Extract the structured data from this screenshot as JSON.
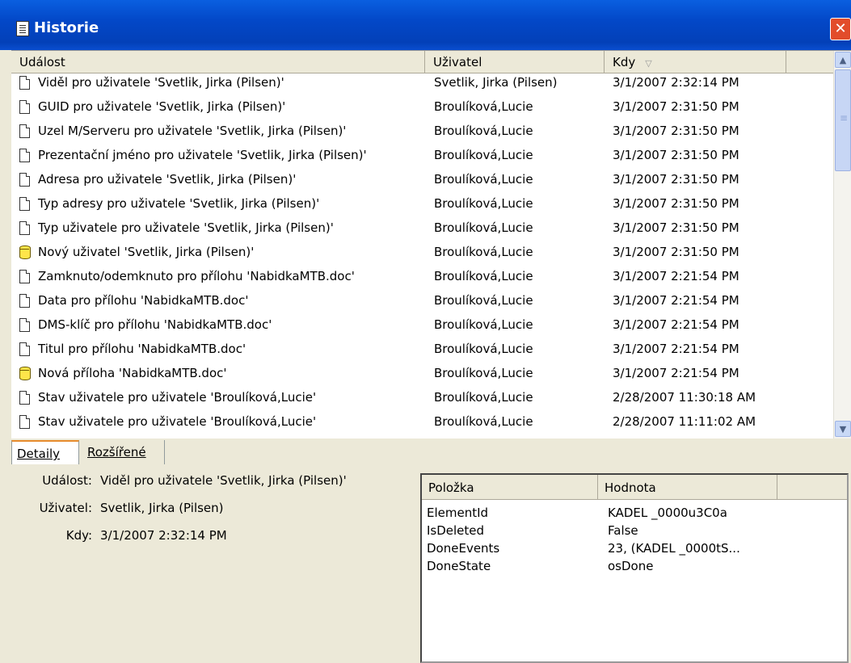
{
  "window": {
    "title": "Historie",
    "icon": "document-list-icon",
    "close_label": "✕"
  },
  "columns": {
    "event": "Událost",
    "user": "Uživatel",
    "when": "Kdy"
  },
  "rows": [
    {
      "icon": "doc",
      "event": "Viděl pro uživatele 'Svetlik, Jirka (Pilsen)'",
      "user": "Svetlik, Jirka (Pilsen)",
      "when": "3/1/2007 2:32:14 PM"
    },
    {
      "icon": "doc",
      "event": "GUID pro uživatele 'Svetlik, Jirka (Pilsen)'",
      "user": "Broulíková,Lucie",
      "when": "3/1/2007 2:31:50 PM"
    },
    {
      "icon": "doc",
      "event": "Uzel M/Serveru pro uživatele 'Svetlik, Jirka (Pilsen)'",
      "user": "Broulíková,Lucie",
      "when": "3/1/2007 2:31:50 PM"
    },
    {
      "icon": "doc",
      "event": "Prezentační jméno pro uživatele 'Svetlik, Jirka (Pilsen)'",
      "user": "Broulíková,Lucie",
      "when": "3/1/2007 2:31:50 PM"
    },
    {
      "icon": "doc",
      "event": "Adresa pro uživatele 'Svetlik, Jirka (Pilsen)'",
      "user": "Broulíková,Lucie",
      "when": "3/1/2007 2:31:50 PM"
    },
    {
      "icon": "doc",
      "event": "Typ adresy pro uživatele 'Svetlik, Jirka (Pilsen)'",
      "user": "Broulíková,Lucie",
      "when": "3/1/2007 2:31:50 PM"
    },
    {
      "icon": "doc",
      "event": "Typ uživatele pro uživatele 'Svetlik, Jirka (Pilsen)'",
      "user": "Broulíková,Lucie",
      "when": "3/1/2007 2:31:50 PM"
    },
    {
      "icon": "db",
      "event": "Nový uživatel 'Svetlik, Jirka (Pilsen)'",
      "user": "Broulíková,Lucie",
      "when": "3/1/2007 2:31:50 PM"
    },
    {
      "icon": "doc",
      "event": "Zamknuto/odemknuto pro přílohu 'NabidkaMTB.doc'",
      "user": "Broulíková,Lucie",
      "when": "3/1/2007 2:21:54 PM"
    },
    {
      "icon": "doc",
      "event": "Data pro přílohu 'NabidkaMTB.doc'",
      "user": "Broulíková,Lucie",
      "when": "3/1/2007 2:21:54 PM"
    },
    {
      "icon": "doc",
      "event": "DMS-klíč pro přílohu 'NabidkaMTB.doc'",
      "user": "Broulíková,Lucie",
      "when": "3/1/2007 2:21:54 PM"
    },
    {
      "icon": "doc",
      "event": "Titul pro přílohu 'NabidkaMTB.doc'",
      "user": "Broulíková,Lucie",
      "when": "3/1/2007 2:21:54 PM"
    },
    {
      "icon": "db",
      "event": "Nová příloha 'NabidkaMTB.doc'",
      "user": "Broulíková,Lucie",
      "when": "3/1/2007 2:21:54 PM"
    },
    {
      "icon": "doc",
      "event": "Stav uživatele pro uživatele 'Broulíková,Lucie'",
      "user": "Broulíková,Lucie",
      "when": "2/28/2007 11:30:18 AM"
    },
    {
      "icon": "doc",
      "event": "Stav uživatele pro uživatele 'Broulíková,Lucie'",
      "user": "Broulíková,Lucie",
      "when": "2/28/2007 11:11:02 AM"
    }
  ],
  "tabs": {
    "details": "Detaily",
    "extended": "Rozšířené"
  },
  "details": {
    "event_label": "Událost:",
    "event_value": "Viděl pro uživatele 'Svetlik, Jirka (Pilsen)'",
    "user_label": "Uživatel:",
    "user_value": "Svetlik, Jirka (Pilsen)",
    "when_label": "Kdy:",
    "when_value": "3/1/2007 2:32:14 PM"
  },
  "properties": {
    "col_item": "Položka",
    "col_value": "Hodnota",
    "rows": [
      {
        "item": "ElementId",
        "value": "KADEL _0000u3C0a"
      },
      {
        "item": "IsDeleted",
        "value": "False"
      },
      {
        "item": "DoneEvents",
        "value": "23, (KADEL _0000tS..."
      },
      {
        "item": "DoneState",
        "value": "osDone"
      }
    ]
  }
}
